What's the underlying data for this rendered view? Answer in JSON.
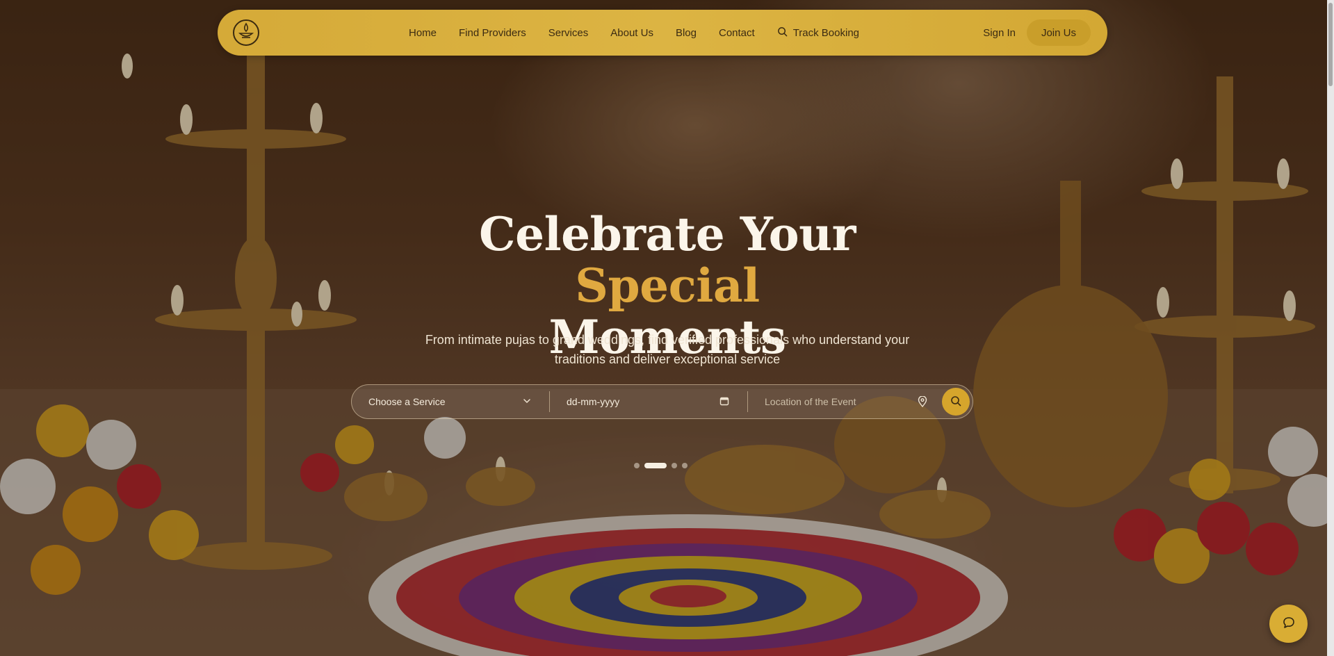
{
  "nav": {
    "links": [
      "Home",
      "Find Providers",
      "Services",
      "About Us",
      "Blog",
      "Contact"
    ],
    "track_label": "Track Booking",
    "sign_in": "Sign In",
    "join": "Join Us"
  },
  "hero": {
    "title_part1": "Celebrate Your",
    "title_accent": "Special",
    "title_part2": "Moments",
    "subtitle": "From intimate pujas to grand weddings, find verified professionals who understand your traditions and deliver exceptional service"
  },
  "search": {
    "service_value": "Choose a Service",
    "date_placeholder": "dd-mm-yyyy",
    "location_placeholder": "Location of the Event"
  },
  "carousel": {
    "slide_count": 4,
    "active_index": 1
  },
  "colors": {
    "brand_gold": "#d5aa38",
    "accent": "#e0a940",
    "chat_button": "#d9ad34"
  },
  "icons": {
    "logo": "diya-lamp-icon",
    "track": "search-icon",
    "service_dropdown": "chevron-down-icon",
    "date": "calendar-icon",
    "location": "map-pin-icon",
    "search_button": "search-icon",
    "chat": "chat-bubble-icon"
  }
}
